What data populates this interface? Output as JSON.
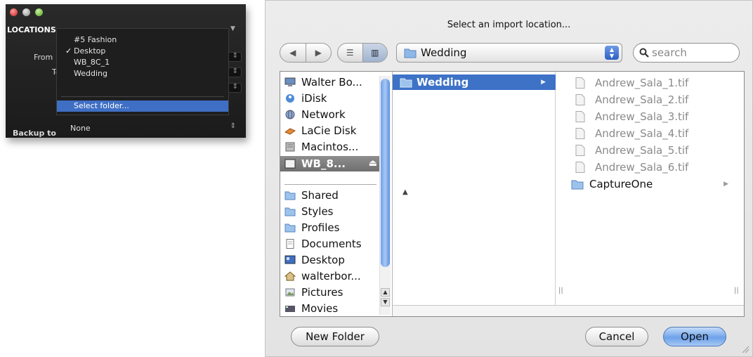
{
  "locations_panel": {
    "header": "LOCATIONS",
    "from_label": "From",
    "to_label": "To",
    "menu_items": [
      {
        "label": "#5 Fashion",
        "checked": false
      },
      {
        "label": "Desktop",
        "checked": true
      },
      {
        "label": "WB_8C_1",
        "checked": false
      },
      {
        "label": "Wedding",
        "checked": false
      }
    ],
    "checkmark": "✓",
    "select_folder": "Select folder...",
    "backup_label": "Backup to",
    "backup_value": "None"
  },
  "dialog": {
    "title": "Select an import location...",
    "path_popup_value": "Wedding",
    "search_placeholder": "search",
    "sidebar": {
      "devices": [
        {
          "label": "Walter Bo...",
          "icon": "computer-icon"
        },
        {
          "label": "iDisk",
          "icon": "idisk-icon"
        },
        {
          "label": "Network",
          "icon": "network-globe-icon"
        },
        {
          "label": "LaCie Disk",
          "icon": "external-drive-icon"
        },
        {
          "label": "Macintos...",
          "icon": "hard-drive-icon"
        },
        {
          "label": "WB_8...",
          "icon": "disk-icon",
          "selected": true,
          "eject": "⏏"
        }
      ],
      "places": [
        {
          "label": "Shared",
          "icon": "folder-icon"
        },
        {
          "label": "Styles",
          "icon": "folder-icon"
        },
        {
          "label": "Profiles",
          "icon": "folder-icon"
        },
        {
          "label": "Documents",
          "icon": "documents-icon"
        },
        {
          "label": "Desktop",
          "icon": "desktop-icon"
        },
        {
          "label": "walterbor...",
          "icon": "home-icon"
        },
        {
          "label": "Pictures",
          "icon": "pictures-icon"
        },
        {
          "label": "Movies",
          "icon": "movies-icon"
        }
      ]
    },
    "column1": {
      "selected_folder": "Wedding"
    },
    "column2": {
      "files": [
        "Andrew_Sala_1.tif",
        "Andrew_Sala_2.tif",
        "Andrew_Sala_3.tif",
        "Andrew_Sala_4.tif",
        "Andrew_Sala_5.tif",
        "Andrew_Sala_6.tif"
      ],
      "folder": "CaptureOne"
    },
    "buttons": {
      "new_folder": "New Folder",
      "cancel": "Cancel",
      "open": "Open"
    },
    "colors": {
      "selection_blue": "#3d72c7",
      "default_button": "#6da2ea",
      "menu_highlight": "#3f6fc4"
    }
  }
}
